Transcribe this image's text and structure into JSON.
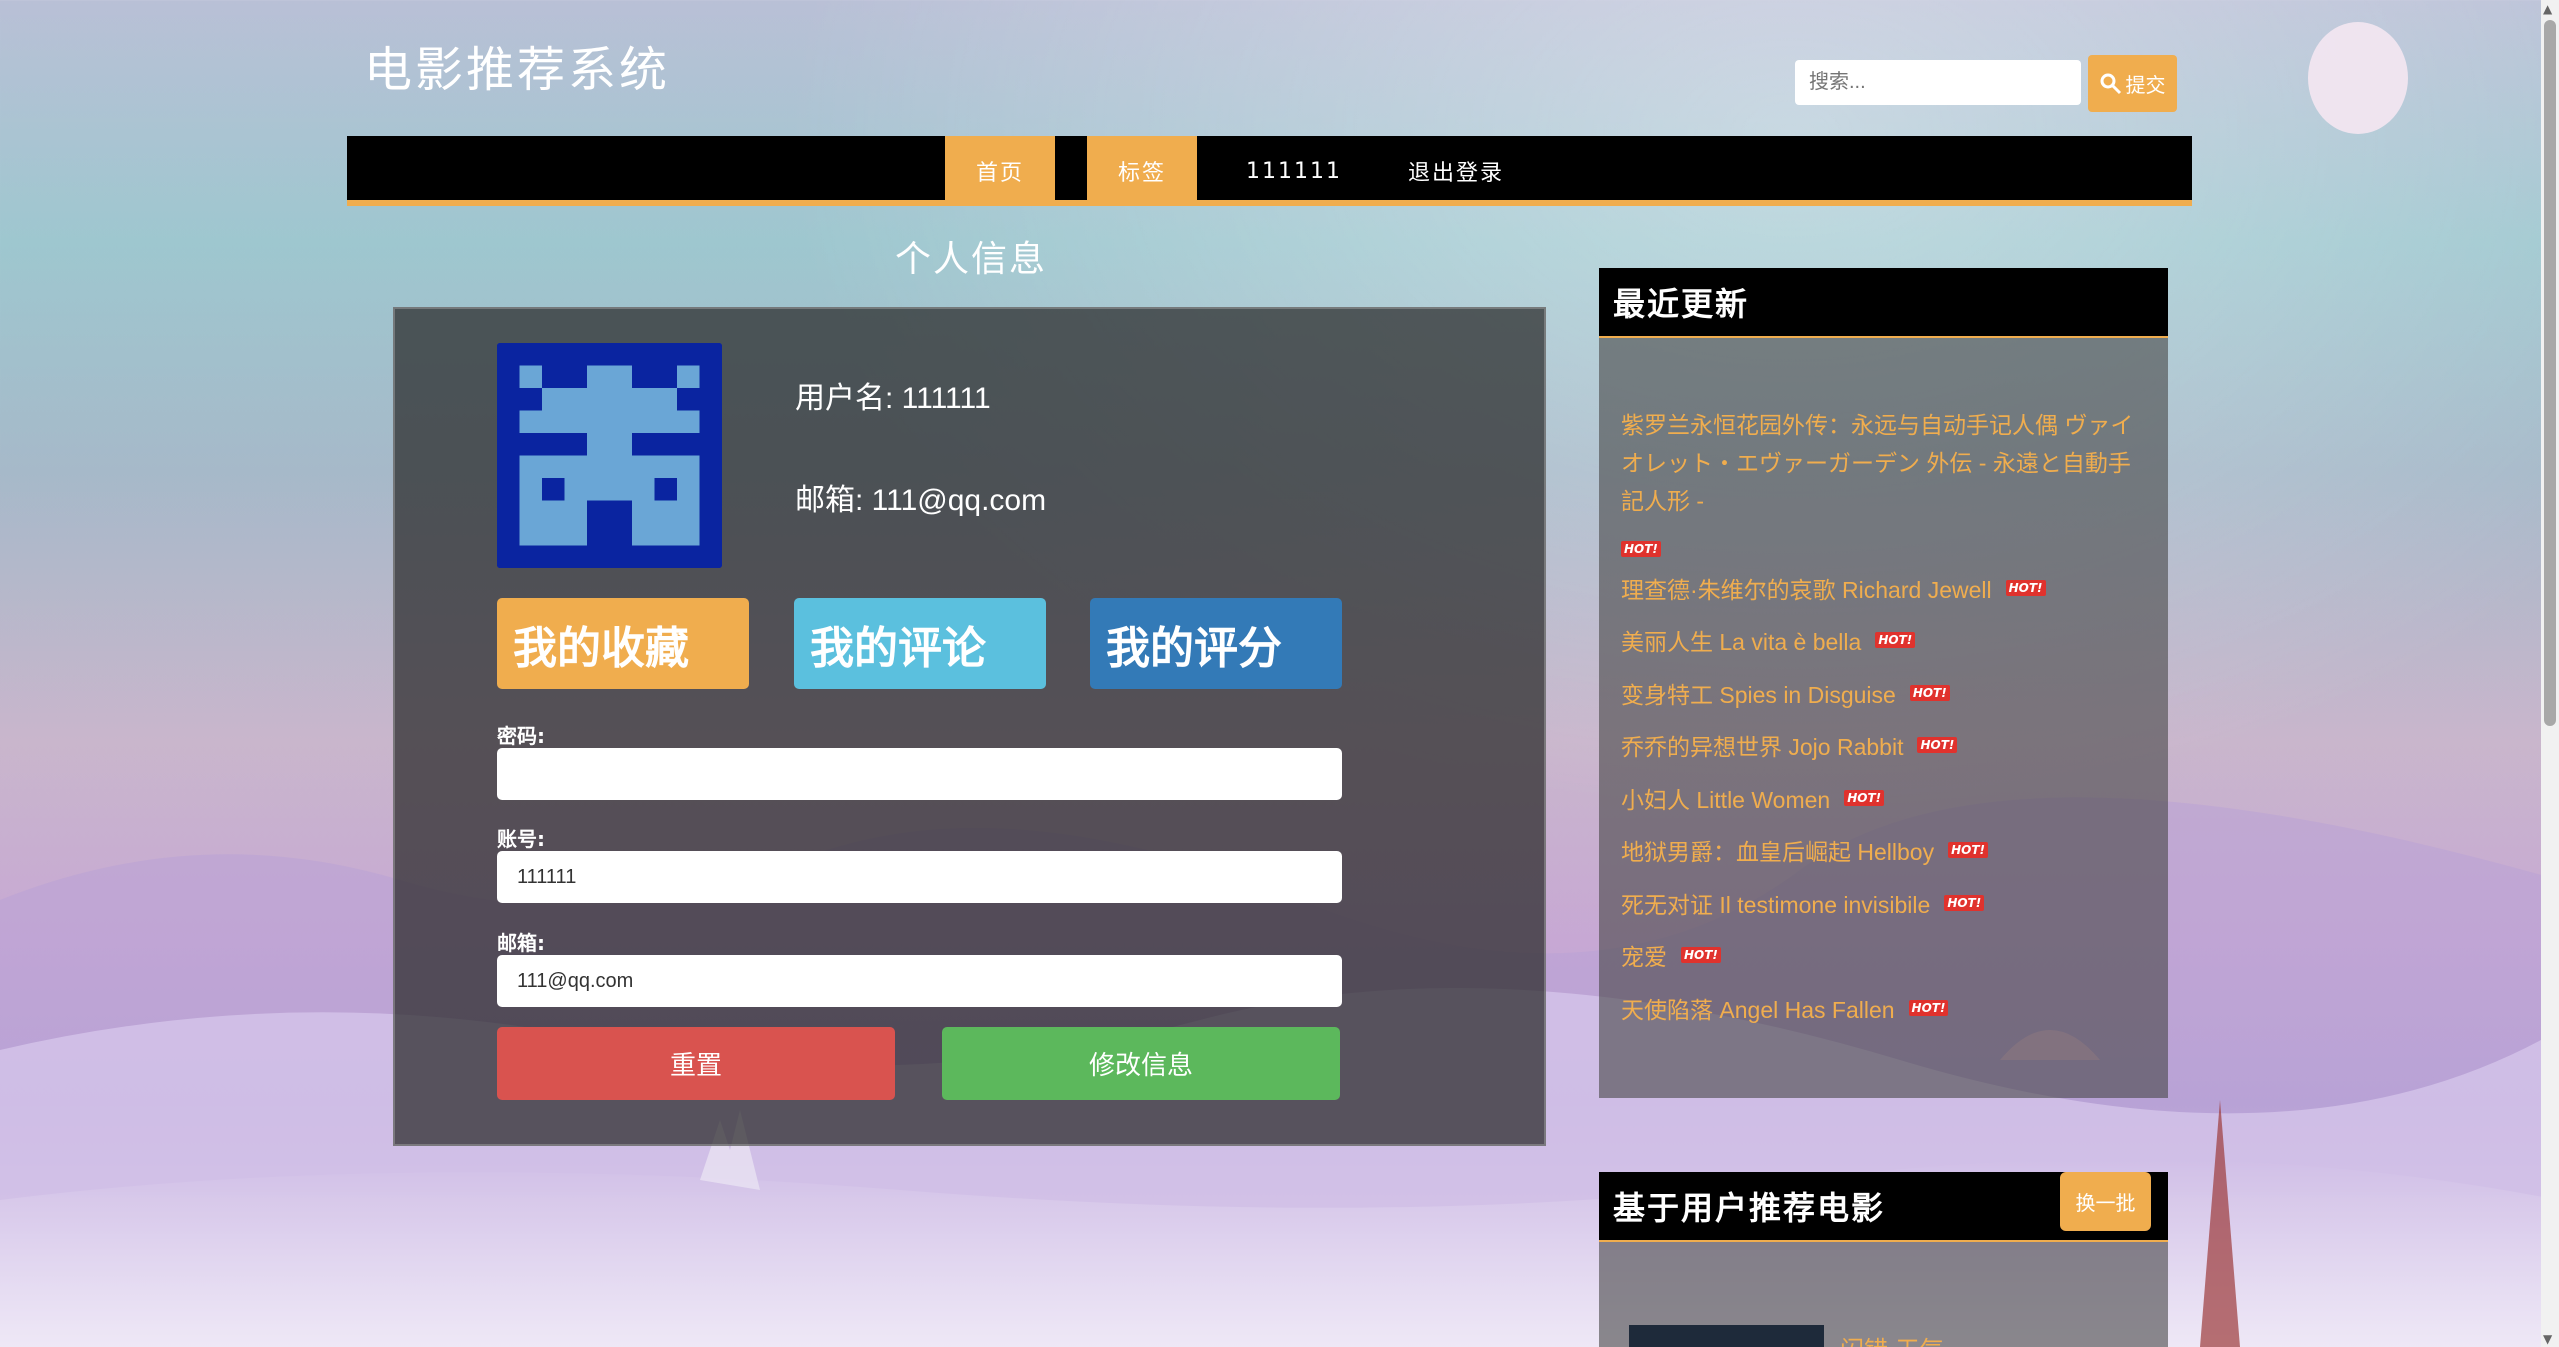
{
  "site": {
    "title": "电影推荐系统"
  },
  "search": {
    "placeholder": "搜索...",
    "submit_label": "提交",
    "icon": "search-icon"
  },
  "nav": {
    "items": [
      {
        "label": "首页",
        "active": true
      },
      {
        "label": "标签",
        "active": true
      },
      {
        "label": "111111",
        "active": false
      },
      {
        "label": "退出登录",
        "active": false
      }
    ]
  },
  "profile": {
    "section_title": "个人信息",
    "username_line": "用户名: 111111",
    "email_line": "邮箱: 111@qq.com",
    "buttons": {
      "favorites": "我的收藏",
      "comments": "我的评论",
      "ratings": "我的评分"
    },
    "form": {
      "password_label": "密码:",
      "password_value": "",
      "account_label": "账号:",
      "account_value": "111111",
      "email_label": "邮箱:",
      "email_value": "111@qq.com",
      "reset_label": "重置",
      "submit_label": "修改信息"
    }
  },
  "recent": {
    "title": "最近更新",
    "hot_badge": "HOT!",
    "items": [
      "紫罗兰永恒花园外传：永远与自动手记人偶 ヴァイオレット・エヴァーガーデン 外伝 - 永遠と自動手記人形 -",
      "理查德·朱维尔的哀歌 Richard Jewell",
      "美丽人生 La vita è bella",
      "变身特工 Spies in Disguise",
      "乔乔的异想世界 Jojo Rabbit",
      "小妇人 Little Women",
      "地狱男爵：血皇后崛起 Hellboy",
      "死无对证 Il testimone invisibile",
      "宠爱",
      "天使陷落 Angel Has Fallen"
    ]
  },
  "recommend": {
    "title": "基于用户推荐电影",
    "swap_label": "换一批",
    "first_title": "闪错 天气"
  },
  "colors": {
    "accent": "#f0ad4e",
    "info": "#5bc0de",
    "primary": "#337ab7",
    "danger": "#d9534f",
    "success": "#5cb85c",
    "avatar_bg": "#0a24a0",
    "avatar_fg": "#6aa6d6"
  }
}
